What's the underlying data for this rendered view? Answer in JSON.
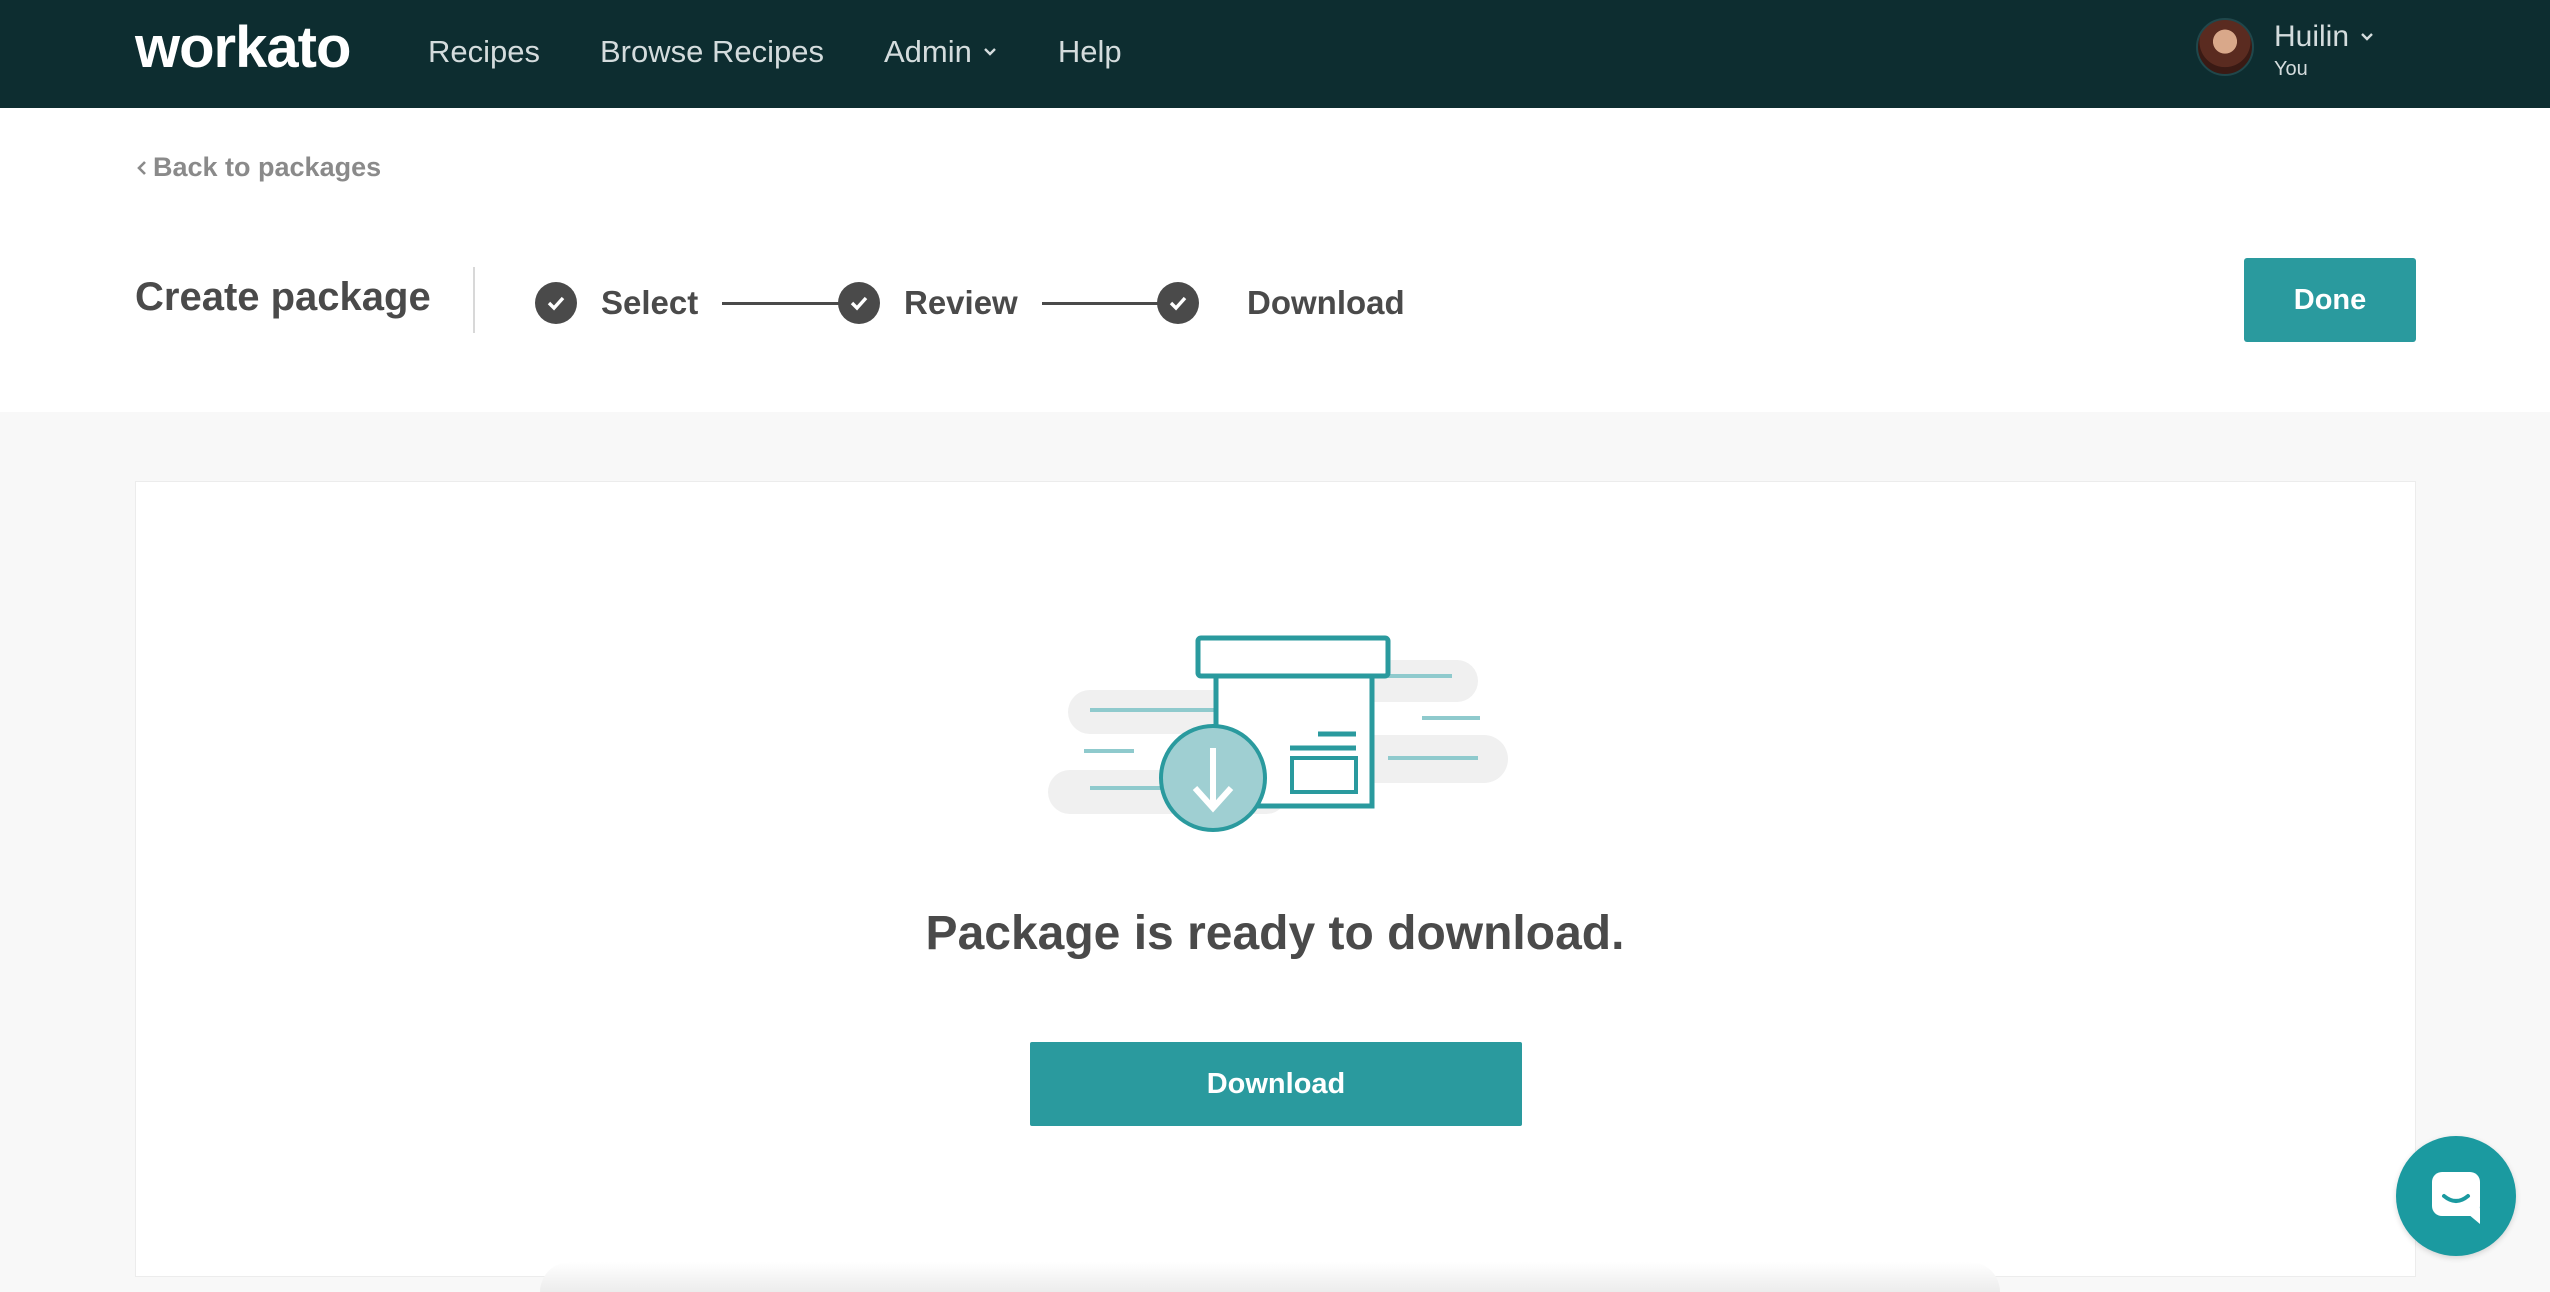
{
  "app": {
    "logo": "workato"
  },
  "nav": {
    "items": [
      {
        "label": "Recipes"
      },
      {
        "label": "Browse Recipes"
      },
      {
        "label": "Admin",
        "has_dropdown": true
      },
      {
        "label": "Help"
      }
    ]
  },
  "user": {
    "name": "Huilin",
    "subtitle": "You"
  },
  "back_link": {
    "label": "Back to packages"
  },
  "page_title": "Create package",
  "steps": [
    {
      "label": "Select",
      "completed": true
    },
    {
      "label": "Review",
      "completed": true
    },
    {
      "label": "Download",
      "completed": true
    }
  ],
  "done_button": {
    "label": "Done"
  },
  "main": {
    "message": "Package is ready to download.",
    "download_button": {
      "label": "Download"
    }
  },
  "icons": {
    "nav_dropdown": "chevron-down-icon",
    "back": "chevron-left-icon",
    "step": "check-circle-icon",
    "illustration": "package-download-icon",
    "chat": "chat-bubble-icon"
  },
  "colors": {
    "topbar": "#0d2d30",
    "accent": "#2a9a9e",
    "text_dark": "#4a4a4a",
    "chat": "#1b9aa0"
  }
}
